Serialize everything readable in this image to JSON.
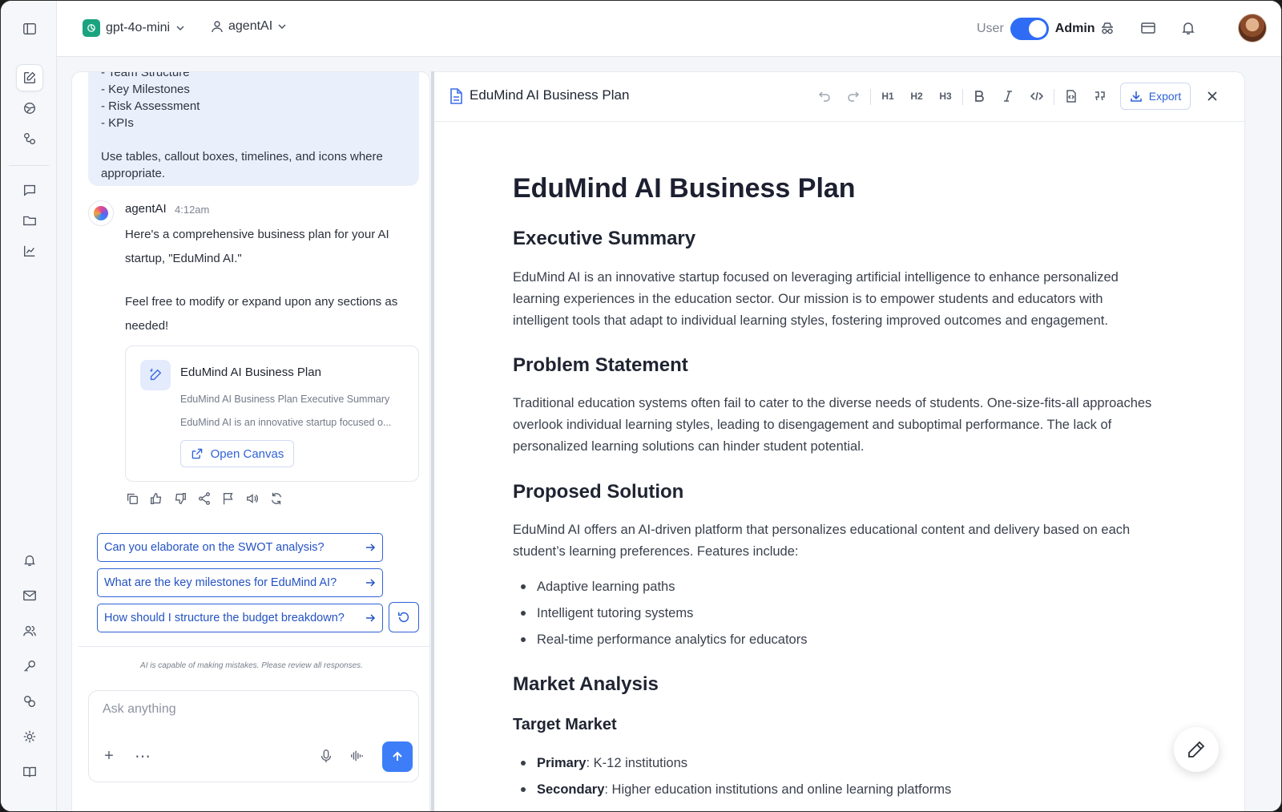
{
  "topbar": {
    "model": "gpt-4o-mini",
    "agent": "agentAI",
    "role_user": "User",
    "role_admin": "Admin"
  },
  "chat": {
    "user_message": {
      "lines": [
        "- Team Structure",
        "- Key Milestones",
        "- Risk Assessment",
        "- KPIs"
      ],
      "closing": "Use tables, callout boxes, timelines, and icons where appropriate."
    },
    "agent": {
      "name": "agentAI",
      "time": "4:12am",
      "message_1": "Here's a comprehensive business plan for your AI startup, \"EduMind AI.\"",
      "message_2": "Feel free to modify or expand upon any sections as needed!"
    },
    "card": {
      "title": "EduMind AI Business Plan",
      "subtitle": "EduMind AI Business Plan Executive Summary",
      "preview": "EduMind AI is an innovative startup focused o...",
      "button": "Open Canvas"
    },
    "suggestions": [
      "Can you elaborate on the SWOT analysis?",
      "What are the key milestones for EduMind AI?",
      "How should I structure the budget breakdown?"
    ],
    "disclaimer": "AI is capable of making mistakes. Please review all responses.",
    "composer": {
      "placeholder": "Ask anything"
    }
  },
  "canvas": {
    "title": "EduMind AI Business Plan",
    "toolbar": {
      "h1": "H1",
      "h2": "H2",
      "h3": "H3",
      "export": "Export"
    },
    "doc": {
      "h1": "EduMind AI Business Plan",
      "sections": [
        {
          "heading": "Executive Summary",
          "body": "EduMind AI is an innovative startup focused on leveraging artificial intelligence to enhance personalized learning experiences in the education sector. Our mission is to empower students and educators with intelligent tools that adapt to individual learning styles, fostering improved outcomes and engagement."
        },
        {
          "heading": "Problem Statement",
          "body": "Traditional education systems often fail to cater to the diverse needs of students. One-size-fits-all approaches overlook individual learning styles, leading to disengagement and suboptimal performance. The lack of personalized learning solutions can hinder student potential."
        },
        {
          "heading": "Proposed Solution",
          "body": "EduMind AI offers an AI-driven platform that personalizes educational content and delivery based on each student’s learning preferences. Features include:",
          "bullets": [
            "Adaptive learning paths",
            "Intelligent tutoring systems",
            "Real-time performance analytics for educators"
          ]
        },
        {
          "heading": "Market Analysis",
          "subheading": "Target Market",
          "items": [
            {
              "label": "Primary",
              "text": ": K-12 institutions"
            },
            {
              "label": "Secondary",
              "text": ": Higher education institutions and online learning platforms"
            }
          ]
        }
      ]
    }
  },
  "colors": {
    "accent": "#2f6cf6",
    "model_logo": "#19a37f"
  }
}
